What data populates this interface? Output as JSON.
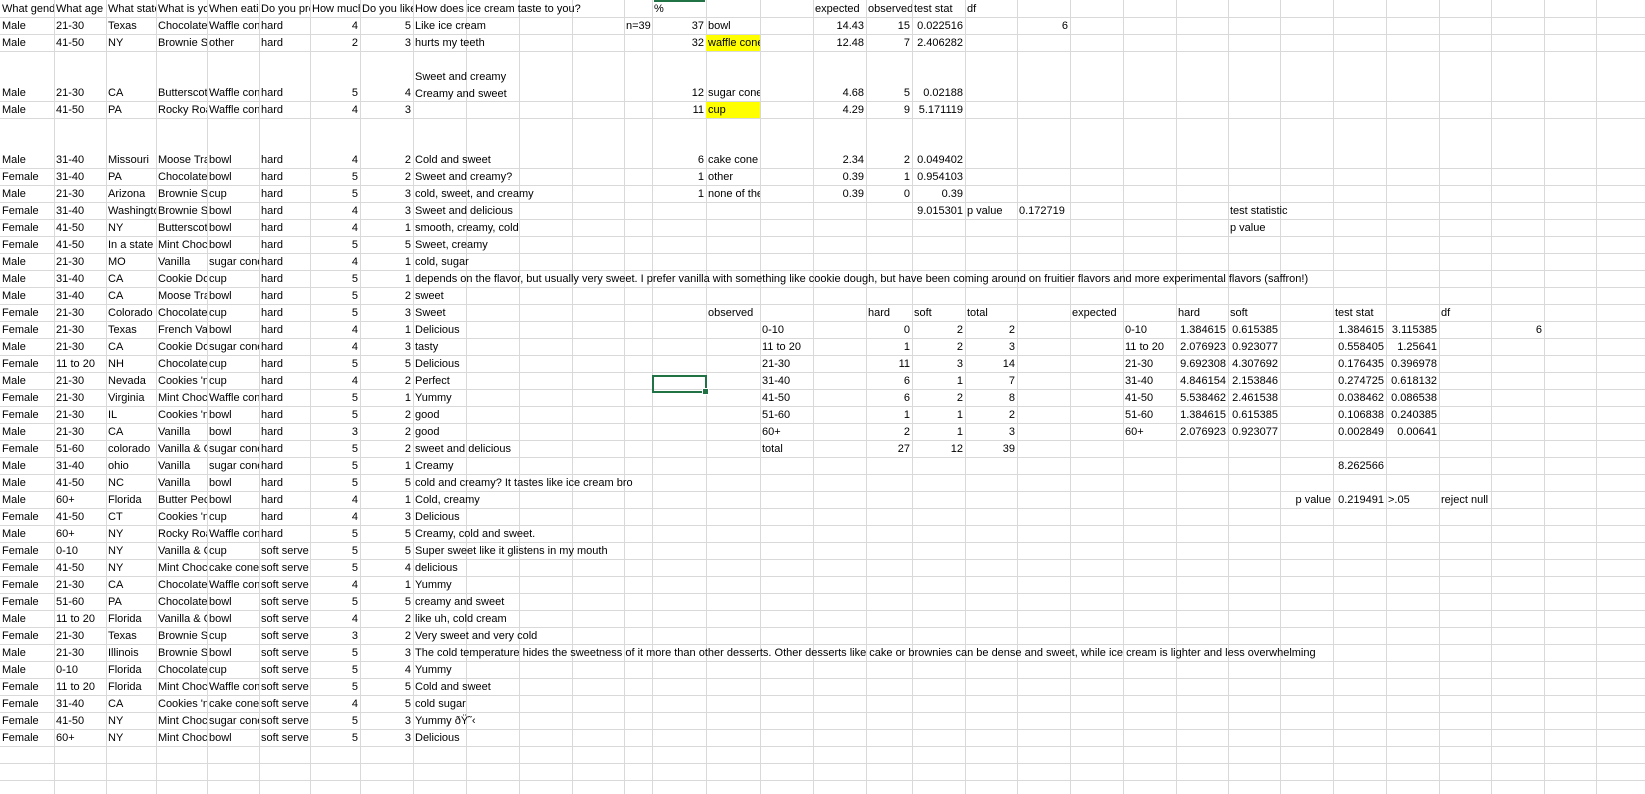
{
  "headers": [
    "What gender are you?",
    "What age range are you in?",
    "What state are you from?",
    "What is your favorite ice cream flavor?",
    "When eating ice cream, what do you prefer to eat it from?",
    "Do you prefer hard or soft serve ice cream?",
    "How much do you like ice cream?",
    "Do you like sweet things?",
    "How does ice cream taste to you?"
  ],
  "rows": [
    [
      "Male",
      "21-30",
      "Texas",
      "Chocolate",
      "Waffle cone",
      "hard",
      "4",
      "5",
      "Like ice cream"
    ],
    [
      "Male",
      "41-50",
      "NY",
      "Brownie Sundae",
      "other",
      "hard",
      "2",
      "3",
      "hurts my teeth"
    ],
    [
      "Male",
      "21-30",
      "CA",
      "Butterscotch",
      "Waffle cone",
      "hard",
      "5",
      "4",
      "Sweet and creamy"
    ],
    [
      "Male",
      "41-50",
      "PA",
      "Rocky Road",
      "Waffle cone",
      "hard",
      "4",
      "3",
      "Creamy and sweet"
    ],
    [
      "Male",
      "31-40",
      "Missouri",
      "Moose Tracks",
      "bowl",
      "hard",
      "4",
      "2",
      "Cold and sweet"
    ],
    [
      "Female",
      "31-40",
      "PA",
      "Chocolate",
      "bowl",
      "hard",
      "5",
      "2",
      "Sweet and creamy?"
    ],
    [
      "Male",
      "21-30",
      "Arizona",
      "Brownie Sundae",
      "cup",
      "hard",
      "5",
      "3",
      "cold, sweet, and creamy"
    ],
    [
      "Female",
      "31-40",
      "Washington",
      "Brownie Sundae",
      "bowl",
      "hard",
      "4",
      "3",
      "Sweet and delicious"
    ],
    [
      "Female",
      "41-50",
      "NY",
      "Butterscotch",
      "bowl",
      "hard",
      "4",
      "1",
      "smooth, creamy, cold"
    ],
    [
      "Female",
      "41-50",
      "In a state",
      "Mint Chocolate Chip",
      "bowl",
      "hard",
      "5",
      "5",
      "Sweet, creamy"
    ],
    [
      "Male",
      "21-30",
      "MO",
      "Vanilla",
      "sugar cone",
      "hard",
      "4",
      "1",
      "cold, sugar"
    ],
    [
      "Male",
      "31-40",
      "CA",
      "Cookie Dough",
      "cup",
      "hard",
      "5",
      "1",
      "depends on the flavor, but usually very sweet. I prefer vanilla with something like cookie dough, but have been coming around on fruitier flavors and more experimental flavors (saffron!)"
    ],
    [
      "Male",
      "31-40",
      "CA",
      "Moose Tracks",
      "bowl",
      "hard",
      "5",
      "2",
      "sweet"
    ],
    [
      "Female",
      "21-30",
      "Colorado",
      "Chocolate",
      "cup",
      "hard",
      "5",
      "3",
      "Sweet"
    ],
    [
      "Female",
      "21-30",
      "Texas",
      "French Vanilla",
      "bowl",
      "hard",
      "4",
      "1",
      "Delicious"
    ],
    [
      "Male",
      "21-30",
      "CA",
      "Cookie Dough",
      "sugar cone",
      "hard",
      "4",
      "3",
      "tasty"
    ],
    [
      "Female",
      "11 to 20",
      "NH",
      "Chocolate",
      "cup",
      "hard",
      "5",
      "5",
      "Delicious"
    ],
    [
      "Male",
      "21-30",
      "Nevada",
      "Cookies 'n Cream",
      "cup",
      "hard",
      "4",
      "2",
      "Perfect"
    ],
    [
      "Female",
      "21-30",
      "Virginia",
      "Mint Chocolate Chip",
      "Waffle cone",
      "hard",
      "5",
      "1",
      "Yummy"
    ],
    [
      "Female",
      "21-30",
      "IL",
      "Cookies 'n Cream",
      "bowl",
      "hard",
      "5",
      "2",
      "good"
    ],
    [
      "Male",
      "21-30",
      "CA",
      "Vanilla",
      "bowl",
      "hard",
      "3",
      "2",
      "good"
    ],
    [
      "Female",
      "51-60",
      "colorado",
      "Vanilla & Chocolate",
      "sugar cone",
      "hard",
      "5",
      "2",
      "sweet and delicious"
    ],
    [
      "Male",
      "31-40",
      "ohio",
      "Vanilla",
      "sugar cone",
      "hard",
      "5",
      "1",
      "Creamy"
    ],
    [
      "Male",
      "41-50",
      "NC",
      "Vanilla",
      "bowl",
      "hard",
      "5",
      "5",
      "cold and creamy?  It tastes like ice cream bro"
    ],
    [
      "Male",
      "60+",
      "Florida",
      "Butter Pecan",
      "bowl",
      "hard",
      "4",
      "1",
      "Cold, creamy"
    ],
    [
      "Female",
      "41-50",
      "CT",
      "Cookies 'n Cream",
      "cup",
      "hard",
      "4",
      "3",
      "Delicious"
    ],
    [
      "Male",
      "60+",
      "NY",
      "Rocky Road",
      "Waffle cone",
      "hard",
      "5",
      "5",
      "Creamy, cold and sweet."
    ],
    [
      "Female",
      "0-10",
      "NY",
      "Vanilla & Chocolate",
      "cup",
      "soft serve",
      "5",
      "5",
      "Super sweet like it glistens in my mouth"
    ],
    [
      "Female",
      "41-50",
      "NY",
      "Mint Chocolate Chip",
      "cake cone",
      "soft serve",
      "5",
      "4",
      "delicious"
    ],
    [
      "Female",
      "21-30",
      "CA",
      "Chocolate",
      "Waffle cone",
      "soft serve",
      "4",
      "1",
      "Yummy"
    ],
    [
      "Female",
      "51-60",
      "PA",
      "Chocolate",
      "bowl",
      "soft serve",
      "5",
      "5",
      "creamy and sweet"
    ],
    [
      "Male",
      "11 to 20",
      "Florida",
      "Vanilla & Chocolate",
      "bowl",
      "soft serve",
      "4",
      "2",
      "like uh, cold cream"
    ],
    [
      "Female",
      "21-30",
      "Texas",
      "Brownie Sundae",
      "cup",
      "soft serve",
      "3",
      "2",
      "Very sweet and very cold"
    ],
    [
      "Male",
      "21-30",
      "Illinois",
      "Brownie Sundae",
      "bowl",
      "soft serve",
      "5",
      "3",
      "The cold temperature hides the sweetness of it more than other desserts. Other desserts like cake or brownies can be dense and sweet, while ice cream is lighter and less overwhelming"
    ],
    [
      "Male",
      "0-10",
      "Florida",
      "Chocolate",
      "cup",
      "soft serve",
      "5",
      "4",
      "Yummy"
    ],
    [
      "Female",
      "11 to 20",
      "Florida",
      "Mint Chocolate Chip",
      "Waffle cone",
      "soft serve",
      "5",
      "5",
      "Cold and sweet"
    ],
    [
      "Female",
      "31-40",
      "CA",
      "Cookies 'n Cream",
      "cake cone",
      "soft serve",
      "4",
      "5",
      "cold sugar"
    ],
    [
      "Female",
      "41-50",
      "NY",
      "Mint Chocolate Chip",
      "sugar cone",
      "soft serve",
      "5",
      "3",
      "Yummy ðŸ˜‹"
    ],
    [
      "Female",
      "60+",
      "NY",
      "Mint Chocolate Chip",
      "bowl",
      "soft serve",
      "5",
      "3",
      "Delicious"
    ]
  ],
  "goodness_of_fit": {
    "n_label": "n=39",
    "headers": {
      "pct": "%",
      "expected": "expected",
      "observed": "observed",
      "test_stat": "test stat",
      "df": "df"
    },
    "df_value": "6",
    "rows": [
      {
        "pct": "37",
        "item": "bowl",
        "expected": "14.43",
        "observed": "15",
        "stat": "0.022516"
      },
      {
        "pct": "32",
        "item": "waffle cone",
        "expected": "12.48",
        "observed": "7",
        "stat": "2.406282"
      },
      {
        "pct": "12",
        "item": "sugar cone",
        "expected": "4.68",
        "observed": "5",
        "stat": "0.02188"
      },
      {
        "pct": "11",
        "item": "cup",
        "expected": "4.29",
        "observed": "9",
        "stat": "5.171119"
      },
      {
        "pct": "6",
        "item": "cake cone",
        "expected": "2.34",
        "observed": "2",
        "stat": "0.049402"
      },
      {
        "pct": "1",
        "item": "other",
        "expected": "0.39",
        "observed": "1",
        "stat": "0.954103"
      },
      {
        "pct": "1",
        "item": "none of the above",
        "expected": "0.39",
        "observed": "0",
        "stat": "0.39"
      }
    ],
    "total_stat": "9.015301",
    "p_value_label": "p value",
    "p_value": "0.172719",
    "note_test_statistic": "test statistic",
    "note_p_value": "p value",
    "highlight_color": "#ffff00"
  },
  "observed_table": {
    "title": "observed",
    "col_hard": "hard",
    "col_soft": "soft",
    "col_total": "total",
    "rows": [
      {
        "age": "0-10",
        "hard": "0",
        "soft": "2",
        "total": "2"
      },
      {
        "age": "11 to 20",
        "hard": "1",
        "soft": "2",
        "total": "3"
      },
      {
        "age": "21-30",
        "hard": "11",
        "soft": "3",
        "total": "14"
      },
      {
        "age": "31-40",
        "hard": "6",
        "soft": "1",
        "total": "7"
      },
      {
        "age": "41-50",
        "hard": "6",
        "soft": "2",
        "total": "8"
      },
      {
        "age": "51-60",
        "hard": "1",
        "soft": "1",
        "total": "2"
      },
      {
        "age": "60+",
        "hard": "2",
        "soft": "1",
        "total": "3"
      },
      {
        "age": "total",
        "hard": "27",
        "soft": "12",
        "total": "39"
      }
    ]
  },
  "expected_table": {
    "title": "expected",
    "col_hard": "hard",
    "col_soft": "soft",
    "rows": [
      {
        "age": "0-10",
        "hard": "1.384615",
        "soft": "0.615385"
      },
      {
        "age": "11 to 20",
        "hard": "2.076923",
        "soft": "0.923077"
      },
      {
        "age": "21-30",
        "hard": "9.692308",
        "soft": "4.307692"
      },
      {
        "age": "31-40",
        "hard": "4.846154",
        "soft": "2.153846"
      },
      {
        "age": "41-50",
        "hard": "5.538462",
        "soft": "2.461538"
      },
      {
        "age": "51-60",
        "hard": "1.384615",
        "soft": "0.615385"
      },
      {
        "age": "60+",
        "hard": "2.076923",
        "soft": "0.923077"
      }
    ]
  },
  "test_stat_table": {
    "title": "test stat",
    "df_label": "df",
    "df_value": "6",
    "rows": [
      {
        "a": "1.384615",
        "b": "3.115385"
      },
      {
        "a": "0.558405",
        "b": "1.25641"
      },
      {
        "a": "0.176435",
        "b": "0.396978"
      },
      {
        "a": "0.274725",
        "b": "0.618132"
      },
      {
        "a": "0.038462",
        "b": "0.086538"
      },
      {
        "a": "0.106838",
        "b": "0.240385"
      },
      {
        "a": "0.002849",
        "b": "0.00641"
      }
    ],
    "sum": "8.262566",
    "p_value_label": "p value",
    "p_value": "0.219491",
    "alpha": ">.05",
    "conclusion": "reject null"
  },
  "grid_color": "#d9d9d9",
  "selection_color": "#217346"
}
